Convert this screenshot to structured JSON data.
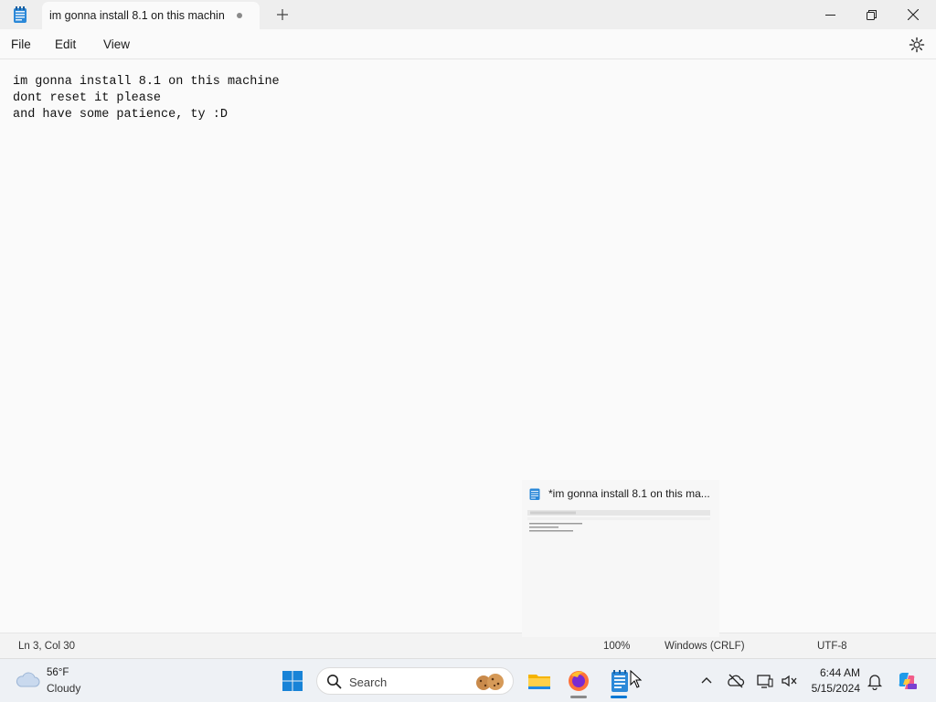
{
  "window": {
    "app_icon": "notepad-icon",
    "tab_title": "im gonna install 8.1 on this machin",
    "tab_unsaved_indicator": "unsaved-dot-icon",
    "new_tab_icon": "plus-icon",
    "controls": [
      "minimize-icon",
      "restore-icon",
      "close-icon"
    ]
  },
  "menubar": {
    "items": [
      "File",
      "Edit",
      "View"
    ],
    "settings_icon": "gear-icon"
  },
  "editor": {
    "lines": [
      "im gonna install 8.1 on this machine",
      "dont reset it please",
      "and have some patience, ty :D"
    ]
  },
  "statusbar": {
    "position": "Ln 3, Col 30",
    "zoom": "100%",
    "line_endings": "Windows (CRLF)",
    "encoding": "UTF-8"
  },
  "preview": {
    "title": "*im gonna install 8.1 on this ma..."
  },
  "taskbar": {
    "weather": {
      "temp": "56°F",
      "condition": "Cloudy",
      "icon": "cloud-icon"
    },
    "start_icon": "windows-start-icon",
    "search": {
      "label": "Search",
      "icon": "search-icon"
    },
    "apps": [
      "file-explorer-icon",
      "firefox-icon",
      "notepad-icon"
    ],
    "tray_icons": [
      "chevron-up-icon",
      "onedrive-offline-icon",
      "display-icon",
      "sound-icon"
    ],
    "clock": {
      "time": "6:44 AM",
      "date": "5/15/2024"
    },
    "notification_icon": "bell-icon",
    "copilot_icon": "copilot-icon",
    "colors": {
      "accent": "#0078d4",
      "firefox_orange": "#ff7139",
      "folder_yellow": "#f5b400"
    }
  }
}
